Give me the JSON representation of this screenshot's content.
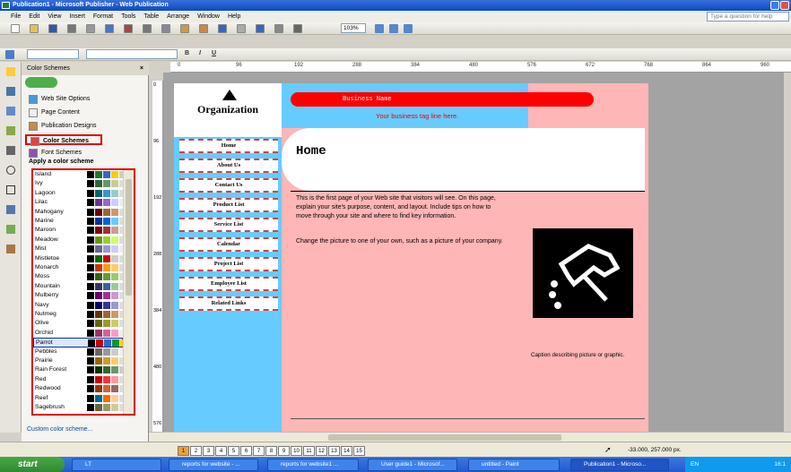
{
  "window": {
    "title": "Publication1 - Microsoft Publisher - Web Publication"
  },
  "menu": {
    "items": [
      "File",
      "Edit",
      "View",
      "Insert",
      "Format",
      "Tools",
      "Table",
      "Arrange",
      "Window",
      "Help"
    ],
    "ask_placeholder": "Type a question for help"
  },
  "toolbar": {
    "zoom": "103%"
  },
  "format_toolbar": {
    "bold": "B",
    "italic": "I",
    "underline": "U"
  },
  "taskpane": {
    "title": "Color Schemes",
    "items": [
      "Web Site Options",
      "Page Content",
      "Publication Designs",
      "Color Schemes",
      "Font Schemes"
    ],
    "apply_label": "Apply a color scheme",
    "custom_link": "Custom color scheme..."
  },
  "schemes": [
    {
      "name": "Island",
      "c": [
        "#000",
        "#1a7a2a",
        "#3366cc",
        "#ffcc00",
        "#ccc"
      ]
    },
    {
      "name": "Ivy",
      "c": [
        "#000",
        "#336633",
        "#669966",
        "#cccc99",
        "#ddd"
      ]
    },
    {
      "name": "Lagoon",
      "c": [
        "#000",
        "#006666",
        "#3399cc",
        "#99cccc",
        "#ddd"
      ]
    },
    {
      "name": "Lilac",
      "c": [
        "#000",
        "#663399",
        "#9966cc",
        "#ccccff",
        "#eee"
      ]
    },
    {
      "name": "Mahogany",
      "c": [
        "#000",
        "#660000",
        "#996633",
        "#cc9966",
        "#ddd"
      ]
    },
    {
      "name": "Marine",
      "c": [
        "#000",
        "#003399",
        "#0066cc",
        "#66ccff",
        "#ddd"
      ]
    },
    {
      "name": "Maroon",
      "c": [
        "#000",
        "#800000",
        "#993333",
        "#cc9999",
        "#ddd"
      ]
    },
    {
      "name": "Meadow",
      "c": [
        "#000",
        "#669900",
        "#99cc33",
        "#ccff66",
        "#ddd"
      ]
    },
    {
      "name": "Mist",
      "c": [
        "#000",
        "#666699",
        "#9999cc",
        "#ccccff",
        "#eee"
      ]
    },
    {
      "name": "Mistletoe",
      "c": [
        "#000",
        "#006600",
        "#cc0000",
        "#cccccc",
        "#ddd"
      ]
    },
    {
      "name": "Monarch",
      "c": [
        "#000",
        "#cc3300",
        "#ff9900",
        "#ffcc66",
        "#ddd"
      ]
    },
    {
      "name": "Moss",
      "c": [
        "#000",
        "#336600",
        "#669933",
        "#99cc66",
        "#ddd"
      ]
    },
    {
      "name": "Mountain",
      "c": [
        "#000",
        "#333366",
        "#336699",
        "#99cc99",
        "#ddd"
      ]
    },
    {
      "name": "Mulberry",
      "c": [
        "#000",
        "#660066",
        "#993399",
        "#cc99cc",
        "#ddd"
      ]
    },
    {
      "name": "Navy",
      "c": [
        "#000",
        "#000066",
        "#333399",
        "#9999cc",
        "#ddd"
      ]
    },
    {
      "name": "Nutmeg",
      "c": [
        "#000",
        "#663300",
        "#996633",
        "#cc9966",
        "#ddd"
      ]
    },
    {
      "name": "Olive",
      "c": [
        "#000",
        "#666600",
        "#999933",
        "#cccc66",
        "#ddd"
      ]
    },
    {
      "name": "Orchid",
      "c": [
        "#000",
        "#993366",
        "#cc6699",
        "#ff99cc",
        "#eee"
      ]
    },
    {
      "name": "Parrot",
      "c": [
        "#000",
        "#cc0000",
        "#3366cc",
        "#009933",
        "#ffcc00"
      ]
    },
    {
      "name": "Pebbles",
      "c": [
        "#000",
        "#666666",
        "#999999",
        "#cccccc",
        "#eee"
      ]
    },
    {
      "name": "Prairie",
      "c": [
        "#000",
        "#996600",
        "#cc9933",
        "#ffcc66",
        "#ddd"
      ]
    },
    {
      "name": "Rain Forest",
      "c": [
        "#000",
        "#003300",
        "#336633",
        "#669966",
        "#ccc"
      ]
    },
    {
      "name": "Red",
      "c": [
        "#000",
        "#cc0000",
        "#ff3333",
        "#ff9999",
        "#ddd"
      ]
    },
    {
      "name": "Redwood",
      "c": [
        "#000",
        "#993300",
        "#cc6633",
        "#996666",
        "#ddd"
      ]
    },
    {
      "name": "Reef",
      "c": [
        "#000",
        "#006699",
        "#ff6600",
        "#ffcc99",
        "#ddd"
      ]
    },
    {
      "name": "Sagebrush",
      "c": [
        "#000",
        "#666633",
        "#999966",
        "#cccc99",
        "#ddd"
      ]
    }
  ],
  "publication": {
    "org_name": "Organization",
    "business_name": "Business Name",
    "tagline": "Your business tag line here.",
    "heading": "Home",
    "nav": [
      "Home",
      "About Us",
      "Contact Us",
      "Product List",
      "Service List",
      "Calendar",
      "Project List",
      "Employee List",
      "Related Links"
    ],
    "body1": "This is the first page of your Web site that visitors will see. On this page, explain your site's purpose, content, and layout. Include tips on how to move through your site and where to find key information.",
    "body2": "Change the picture to one of your own, such as a picture of your company.",
    "caption": "Caption describing picture or graphic."
  },
  "ruler": {
    "h_ticks": [
      "0",
      "96",
      "192",
      "288",
      "384",
      "480",
      "576",
      "672",
      "768",
      "864",
      "960"
    ],
    "v_ticks": [
      "0",
      "96",
      "192",
      "288",
      "384",
      "480",
      "576"
    ]
  },
  "status": {
    "pages": [
      "1",
      "2",
      "3",
      "4",
      "5",
      "6",
      "7",
      "8",
      "9",
      "10",
      "11",
      "12",
      "13",
      "14",
      "15"
    ],
    "coords": "-33.000, 257.000 px."
  },
  "taskbar": {
    "start": "start",
    "tasks": [
      "LT",
      "reports for website - ...",
      "reports for website1 ...",
      "User guide1 - Microsof...",
      "untitled - Paint",
      "Publication1 - Microso..."
    ],
    "lang": "EN",
    "clock": "16:1"
  }
}
